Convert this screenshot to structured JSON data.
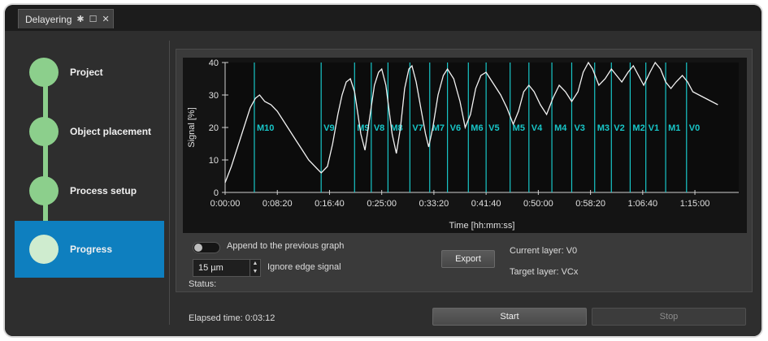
{
  "window": {
    "tab_title": "Delayering",
    "tab_icons": [
      "pin-icon",
      "maximize-icon",
      "close-icon"
    ]
  },
  "sidebar": {
    "steps": [
      {
        "label": "Project",
        "active": false
      },
      {
        "label": "Object placement",
        "active": false
      },
      {
        "label": "Process setup",
        "active": false
      },
      {
        "label": "Progress",
        "active": true
      }
    ]
  },
  "controls": {
    "append_label": "Append to the previous graph",
    "append_enabled": false,
    "edge_value": "15 µm",
    "edge_label": "Ignore edge signal",
    "export_label": "Export",
    "current_layer_label": "Current layer: V0",
    "target_layer_label": "Target  layer: VCx"
  },
  "status_label": "Status:",
  "elapsed_label": "Elapsed time: 0:03:12",
  "buttons": {
    "start": "Start",
    "stop": "Stop"
  },
  "colors": {
    "marker": "#18c6c8",
    "signal": "#f2f2f2",
    "active_step": "#0e7fbf",
    "step": "#8ccf8c"
  },
  "chart_data": {
    "type": "line",
    "xlabel": "Time [hh:mm:ss]",
    "ylabel": "Signal [%]",
    "xlim": [
      0,
      4920
    ],
    "ylim": [
      0,
      40
    ],
    "x_ticks": [
      {
        "t": 0,
        "label": "0:00:00"
      },
      {
        "t": 500,
        "label": "0:08:20"
      },
      {
        "t": 1000,
        "label": "0:16:40"
      },
      {
        "t": 1500,
        "label": "0:25:00"
      },
      {
        "t": 2000,
        "label": "0:33:20"
      },
      {
        "t": 2500,
        "label": "0:41:40"
      },
      {
        "t": 3000,
        "label": "0:50:00"
      },
      {
        "t": 3500,
        "label": "0:58:20"
      },
      {
        "t": 4000,
        "label": "1:06:40"
      },
      {
        "t": 4500,
        "label": "1:15:00"
      }
    ],
    "y_ticks": [
      0,
      10,
      20,
      30,
      40
    ],
    "markers": [
      {
        "t": 280,
        "label": "M10"
      },
      {
        "t": 920,
        "label": "V9"
      },
      {
        "t": 1240,
        "label": "M9"
      },
      {
        "t": 1400,
        "label": "V8"
      },
      {
        "t": 1560,
        "label": "M8"
      },
      {
        "t": 1770,
        "label": "V7"
      },
      {
        "t": 1960,
        "label": "M7"
      },
      {
        "t": 2130,
        "label": "V6"
      },
      {
        "t": 2330,
        "label": "M6"
      },
      {
        "t": 2500,
        "label": "V5"
      },
      {
        "t": 2730,
        "label": "M5"
      },
      {
        "t": 2910,
        "label": "V4"
      },
      {
        "t": 3130,
        "label": "M4"
      },
      {
        "t": 3320,
        "label": "V3"
      },
      {
        "t": 3540,
        "label": "M3"
      },
      {
        "t": 3700,
        "label": "V2"
      },
      {
        "t": 3880,
        "label": "M2"
      },
      {
        "t": 4030,
        "label": "V1"
      },
      {
        "t": 4220,
        "label": "M1"
      },
      {
        "t": 4420,
        "label": "V0"
      }
    ],
    "series": [
      {
        "points": [
          [
            0,
            3
          ],
          [
            60,
            8
          ],
          [
            120,
            14
          ],
          [
            180,
            20
          ],
          [
            240,
            26
          ],
          [
            290,
            29
          ],
          [
            330,
            30
          ],
          [
            380,
            28
          ],
          [
            440,
            27
          ],
          [
            500,
            25
          ],
          [
            560,
            22
          ],
          [
            620,
            19
          ],
          [
            680,
            16
          ],
          [
            740,
            13
          ],
          [
            800,
            10
          ],
          [
            860,
            8
          ],
          [
            920,
            6
          ],
          [
            980,
            8
          ],
          [
            1030,
            15
          ],
          [
            1080,
            24
          ],
          [
            1120,
            30
          ],
          [
            1160,
            34
          ],
          [
            1200,
            35
          ],
          [
            1240,
            31
          ],
          [
            1300,
            18
          ],
          [
            1340,
            13
          ],
          [
            1380,
            22
          ],
          [
            1430,
            33
          ],
          [
            1470,
            37
          ],
          [
            1500,
            38
          ],
          [
            1540,
            33
          ],
          [
            1600,
            18
          ],
          [
            1640,
            12
          ],
          [
            1680,
            20
          ],
          [
            1720,
            32
          ],
          [
            1760,
            38
          ],
          [
            1790,
            39
          ],
          [
            1830,
            34
          ],
          [
            1880,
            25
          ],
          [
            1920,
            18
          ],
          [
            1950,
            14
          ],
          [
            1990,
            20
          ],
          [
            2040,
            30
          ],
          [
            2090,
            36
          ],
          [
            2130,
            38
          ],
          [
            2190,
            35
          ],
          [
            2250,
            28
          ],
          [
            2300,
            20
          ],
          [
            2350,
            24
          ],
          [
            2400,
            32
          ],
          [
            2450,
            36
          ],
          [
            2500,
            37
          ],
          [
            2560,
            34
          ],
          [
            2640,
            30
          ],
          [
            2700,
            26
          ],
          [
            2760,
            21
          ],
          [
            2810,
            25
          ],
          [
            2860,
            31
          ],
          [
            2910,
            33
          ],
          [
            2960,
            31
          ],
          [
            3020,
            27
          ],
          [
            3080,
            24
          ],
          [
            3140,
            29
          ],
          [
            3200,
            33
          ],
          [
            3260,
            31
          ],
          [
            3320,
            28
          ],
          [
            3380,
            31
          ],
          [
            3430,
            37
          ],
          [
            3480,
            40
          ],
          [
            3520,
            38
          ],
          [
            3580,
            33
          ],
          [
            3640,
            35
          ],
          [
            3700,
            38
          ],
          [
            3750,
            36
          ],
          [
            3800,
            34
          ],
          [
            3860,
            37
          ],
          [
            3910,
            39
          ],
          [
            3960,
            36
          ],
          [
            4010,
            33
          ],
          [
            4070,
            37
          ],
          [
            4120,
            40
          ],
          [
            4170,
            38
          ],
          [
            4220,
            34
          ],
          [
            4270,
            32
          ],
          [
            4320,
            34
          ],
          [
            4380,
            36
          ],
          [
            4430,
            34
          ],
          [
            4480,
            31
          ],
          [
            4540,
            30
          ],
          [
            4600,
            29
          ],
          [
            4660,
            28
          ],
          [
            4720,
            27
          ]
        ]
      }
    ]
  }
}
